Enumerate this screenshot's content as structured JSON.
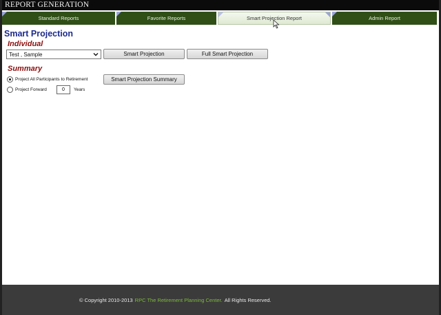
{
  "app": {
    "title": "REPORT GENERATION"
  },
  "tabs": [
    {
      "label": "Standard Reports",
      "active": false
    },
    {
      "label": "Favorite Reports",
      "active": false
    },
    {
      "label": "Smart Projection Report",
      "active": true
    },
    {
      "label": "Admin Report",
      "active": false
    }
  ],
  "page": {
    "title": "Smart Projection"
  },
  "individual": {
    "heading": "Individual",
    "participant_select": {
      "selected": "Test , Sample"
    },
    "smart_projection_button": "Smart Projection",
    "full_smart_projection_button": "Full Smart Projection"
  },
  "summary": {
    "heading": "Summary",
    "option_all": {
      "label": "Project All Participants to Retirement",
      "checked": true
    },
    "option_forward": {
      "label": "Project Forward",
      "checked": false
    },
    "years_value": "0",
    "years_label": "Years",
    "summary_button": "Smart Projection Summary"
  },
  "footer": {
    "copyright": "© Copyright 2010-2013",
    "link": "RPC The Retirement Planning Center.",
    "rights": "All Rights Reserved."
  },
  "colors": {
    "tab_green": "#2f4f17",
    "title_blue": "#1c2a8c",
    "section_red": "#8b0d0d",
    "footer_link_green": "#7dbb3a"
  }
}
